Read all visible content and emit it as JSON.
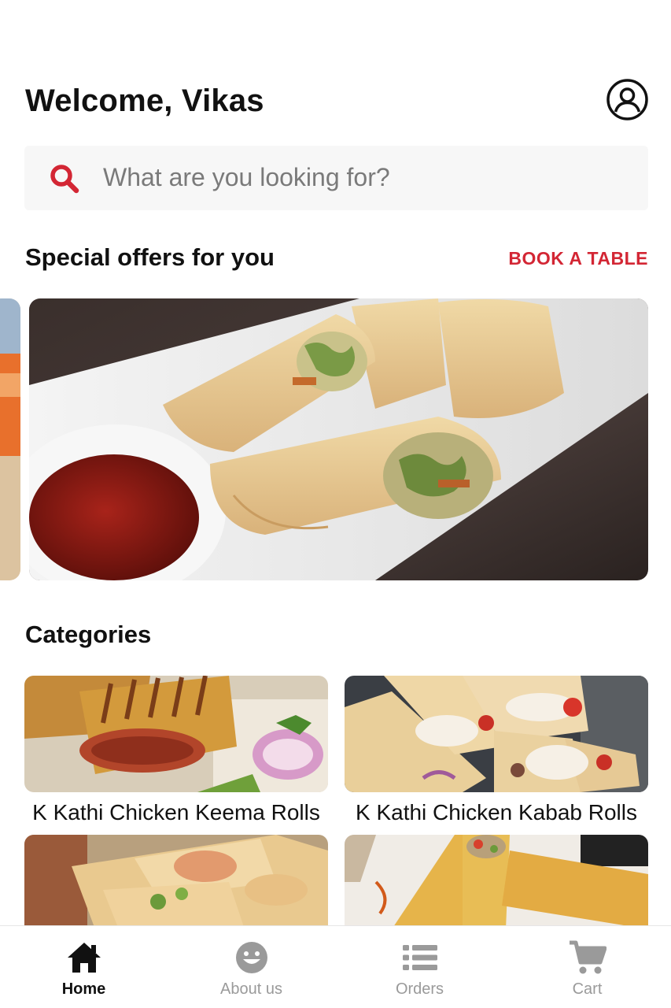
{
  "header": {
    "welcome_text": "Welcome, Vikas",
    "profile_icon": "user-circle-icon"
  },
  "search": {
    "placeholder": "What are you looking for?",
    "icon": "search-icon"
  },
  "offers": {
    "title": "Special offers for you",
    "action_label": "BOOK A TABLE"
  },
  "categories": {
    "title": "Categories",
    "items": [
      {
        "label": "K Kathi Chicken Keema Rolls"
      },
      {
        "label": "K Kathi Chicken Kabab Rolls"
      },
      {
        "label": ""
      },
      {
        "label": ""
      }
    ]
  },
  "bottom_nav": {
    "items": [
      {
        "label": "Home",
        "icon": "home-icon",
        "active": true
      },
      {
        "label": "About us",
        "icon": "smile-icon",
        "active": false
      },
      {
        "label": "Orders",
        "icon": "list-icon",
        "active": false
      },
      {
        "label": "Cart",
        "icon": "cart-icon",
        "active": false
      }
    ]
  },
  "colors": {
    "accent": "#d32634",
    "text": "#111111",
    "muted": "#9a9a9a",
    "search_bg": "#f7f7f7"
  }
}
